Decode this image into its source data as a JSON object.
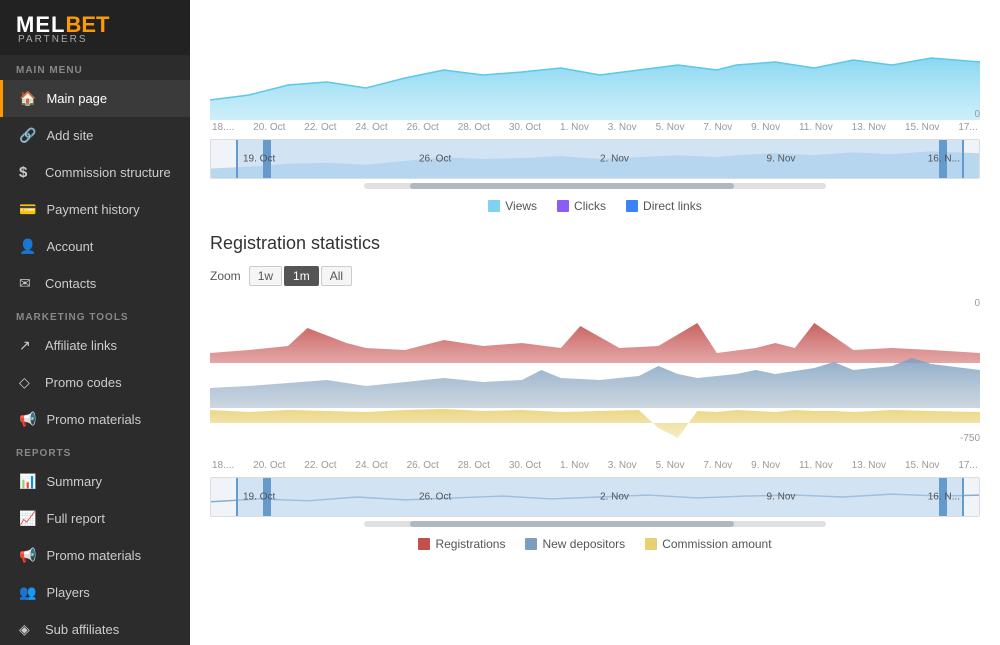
{
  "logo": {
    "mel": "MEL",
    "bet": "BET",
    "partners": "PARTNERS"
  },
  "sidebar": {
    "main_menu_label": "MAIN MENU",
    "marketing_tools_label": "MARKETING TOOLS",
    "reports_label": "REPORTS",
    "items": [
      {
        "id": "main-page",
        "label": "Main page",
        "icon": "🏠",
        "active": true
      },
      {
        "id": "add-site",
        "label": "Add site",
        "icon": "🔗"
      },
      {
        "id": "commission-structure",
        "label": "Commission structure",
        "icon": "$"
      },
      {
        "id": "payment-history",
        "label": "Payment history",
        "icon": "💳"
      },
      {
        "id": "account",
        "label": "Account",
        "icon": "👤"
      },
      {
        "id": "contacts",
        "label": "Contacts",
        "icon": "✉"
      },
      {
        "id": "affiliate-links",
        "label": "Affiliate links",
        "icon": "↗"
      },
      {
        "id": "promo-codes",
        "label": "Promo codes",
        "icon": "◇"
      },
      {
        "id": "promo-materials",
        "label": "Promo materials",
        "icon": "📢"
      },
      {
        "id": "summary",
        "label": "Summary",
        "icon": "📊"
      },
      {
        "id": "full-report",
        "label": "Full report",
        "icon": "📈"
      },
      {
        "id": "promo-materials-2",
        "label": "Promo materials",
        "icon": "📢"
      },
      {
        "id": "players",
        "label": "Players",
        "icon": "👥"
      },
      {
        "id": "sub-affiliates",
        "label": "Sub affiliates",
        "icon": "◈"
      }
    ]
  },
  "top_chart": {
    "y_top": "0",
    "y_bottom": "0",
    "x_labels": [
      "18....",
      "20. Oct",
      "22. Oct",
      "24. Oct",
      "26. Oct",
      "28. Oct",
      "30. Oct",
      "1. Nov",
      "3. Nov",
      "5. Nov",
      "7. Nov",
      "9. Nov",
      "11. Nov",
      "13. Nov",
      "15. Nov",
      "17..."
    ]
  },
  "top_legend": {
    "items": [
      {
        "label": "Views",
        "color": "#7dd3f0"
      },
      {
        "label": "Clicks",
        "color": "#8b5cf6"
      },
      {
        "label": "Direct links",
        "color": "#3b82f6"
      }
    ]
  },
  "navigator_top": {
    "labels": [
      "19. Oct",
      "26. Oct",
      "2. Nov",
      "9. Nov",
      "16. N..."
    ]
  },
  "registration": {
    "title": "Registration statistics",
    "zoom": {
      "label": "Zoom",
      "options": [
        "1w",
        "1m",
        "All"
      ],
      "active": "1m"
    }
  },
  "reg_chart": {
    "y_top": "0",
    "y_bottom": "-750",
    "x_labels": [
      "18....",
      "20. Oct",
      "22. Oct",
      "24. Oct",
      "26. Oct",
      "28. Oct",
      "30. Oct",
      "1. Nov",
      "3. Nov",
      "5. Nov",
      "7. Nov",
      "9. Nov",
      "11. Nov",
      "13. Nov",
      "15. Nov",
      "17..."
    ]
  },
  "navigator_bottom": {
    "labels": [
      "19. Oct",
      "26. Oct",
      "2. Nov",
      "9. Nov",
      "16. N..."
    ]
  },
  "reg_legend": {
    "items": [
      {
        "label": "Registrations",
        "color": "#c0504d"
      },
      {
        "label": "New depositors",
        "color": "#7a9dc0"
      },
      {
        "label": "Commission amount",
        "color": "#e8d070"
      }
    ]
  }
}
